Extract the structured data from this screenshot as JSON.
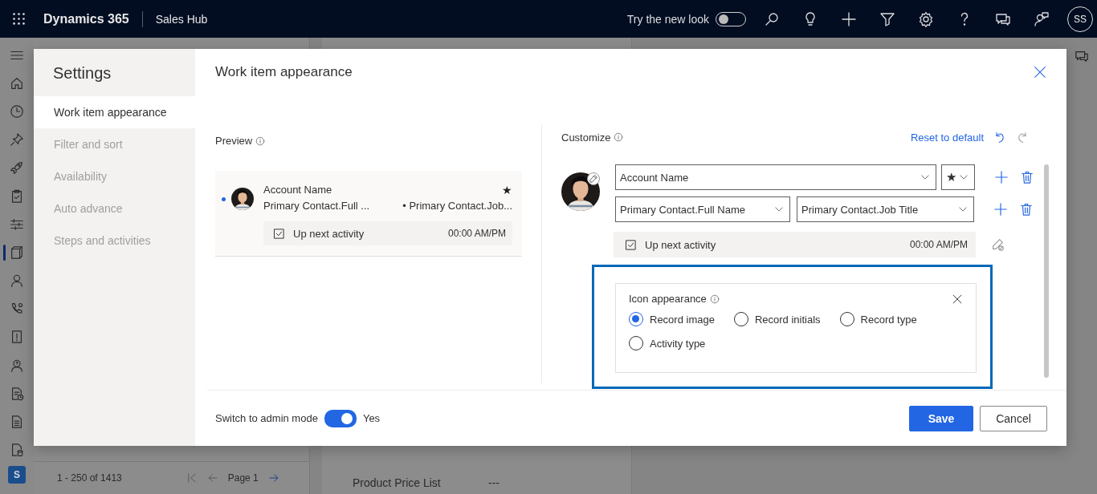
{
  "top_bar": {
    "brand": "Dynamics 365",
    "app": "Sales Hub",
    "new_look": {
      "label": "Try the new look",
      "on": false
    },
    "actions": [
      {
        "kind": "search"
      },
      {
        "kind": "lightbulb"
      },
      {
        "kind": "plus"
      },
      {
        "kind": "filter"
      },
      {
        "kind": "settings"
      },
      {
        "kind": "help"
      },
      {
        "kind": "chat"
      },
      {
        "kind": "person-chat"
      }
    ],
    "avatar": "SS"
  },
  "nav_rail": {
    "items": [
      {
        "kind": "menu",
        "selected": false
      },
      {
        "kind": "home",
        "selected": false
      },
      {
        "kind": "clock",
        "selected": false
      },
      {
        "kind": "pin",
        "selected": false
      },
      {
        "kind": "rocket",
        "selected": false
      },
      {
        "kind": "clipboard",
        "selected": false
      },
      {
        "kind": "sliders",
        "selected": false
      },
      {
        "kind": "board",
        "selected": true
      },
      {
        "kind": "person",
        "selected": false
      },
      {
        "kind": "phone",
        "selected": false
      },
      {
        "kind": "alert",
        "selected": false
      },
      {
        "kind": "contact",
        "selected": false
      },
      {
        "kind": "doc-clock",
        "selected": false
      },
      {
        "kind": "document",
        "selected": false
      },
      {
        "kind": "doc-stack",
        "selected": false
      }
    ],
    "area_badge": "S"
  },
  "background": {
    "list_pager": {
      "range": "1 - 250 of 1413",
      "page": "Page 1"
    },
    "detail_field": {
      "label": "Product Price List",
      "value": "---"
    },
    "side_actions": [
      {
        "kind": "chat"
      }
    ]
  },
  "dialog": {
    "sidebar": {
      "title": "Settings",
      "items": [
        {
          "label": "Work item appearance",
          "selected": true,
          "disabled": false
        },
        {
          "label": "Filter and sort",
          "selected": false,
          "disabled": true
        },
        {
          "label": "Availability",
          "selected": false,
          "disabled": true
        },
        {
          "label": "Auto advance",
          "selected": false,
          "disabled": true
        },
        {
          "label": "Steps and activities",
          "selected": false,
          "disabled": true
        }
      ]
    },
    "title": "Work item appearance",
    "preview": {
      "label": "Preview",
      "card": {
        "unread": true,
        "starred": true,
        "star": "★",
        "title": "Account Name",
        "line_1": "Primary Contact.Full ...",
        "line_2": "• Primary Contact.Job...",
        "activity": {
          "label": "Up next activity",
          "checked": true,
          "time": "00:00 AM/PM"
        }
      }
    },
    "customize": {
      "label": "Customize",
      "reset": "Reset to default",
      "rows": [
        {
          "fields": [
            {
              "kind": "wide",
              "value": "Account Name"
            },
            {
              "kind": "narrow",
              "value": "★"
            }
          ]
        },
        {
          "fields": [
            {
              "kind": "half",
              "value": "Primary Contact.Full Name"
            },
            {
              "kind": "half",
              "value": "Primary Contact.Job Title"
            }
          ]
        }
      ],
      "activity": {
        "label": "Up next activity",
        "checked": true,
        "time": "00:00 AM/PM"
      },
      "icon_appearance": {
        "title": "Icon appearance",
        "highlighted": true,
        "options": [
          {
            "label": "Record image",
            "selected": true
          },
          {
            "label": "Record initials",
            "selected": false
          },
          {
            "label": "Record type",
            "selected": false
          },
          {
            "label": "Activity type",
            "selected": false
          }
        ]
      }
    },
    "footer": {
      "admin_mode": {
        "label": "Switch to admin mode",
        "on": true,
        "value": "Yes"
      },
      "buttons": [
        {
          "kind": "primary",
          "label": "Save"
        },
        {
          "kind": "secondary",
          "label": "Cancel"
        }
      ]
    }
  }
}
